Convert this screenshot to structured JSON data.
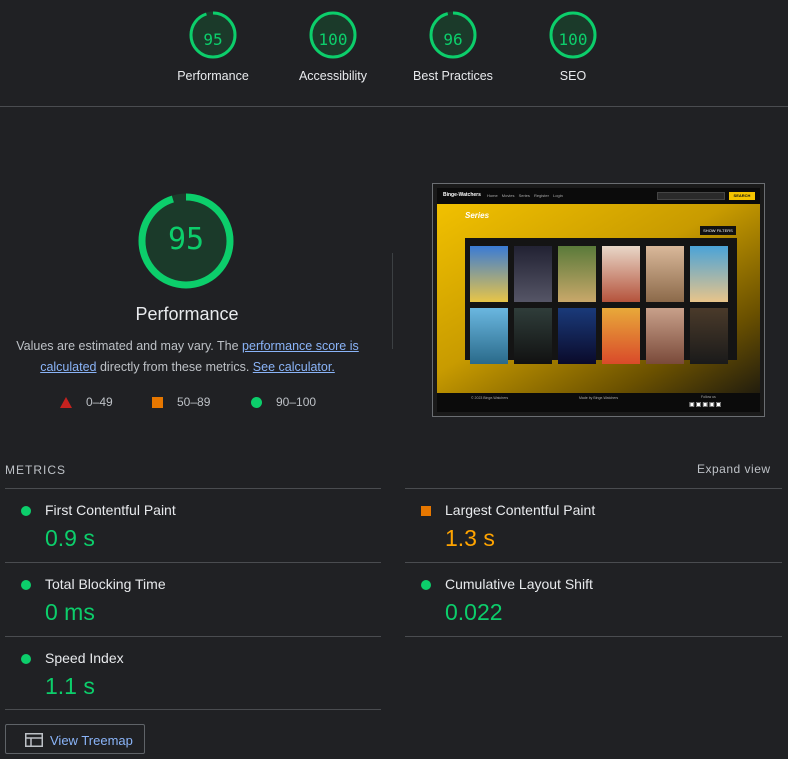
{
  "top_gauges": [
    {
      "score": "95",
      "label": "Performance",
      "fraction": 0.95
    },
    {
      "score": "100",
      "label": "Accessibility",
      "fraction": 1.0
    },
    {
      "score": "96",
      "label": "Best Practices",
      "fraction": 0.96
    },
    {
      "score": "100",
      "label": "SEO",
      "fraction": 1.0
    }
  ],
  "main_gauge": {
    "score": "95",
    "label": "Performance",
    "fraction": 0.95
  },
  "description": {
    "text1": "Values are estimated and may vary. The ",
    "link1": "performance score is calculated",
    "text2": " directly from these metrics. ",
    "link2": "See calculator."
  },
  "legend": [
    {
      "icon": "triangle-icon",
      "range": "0–49",
      "color": "#c5221f"
    },
    {
      "icon": "square-icon",
      "range": "50–89",
      "color": "#e67700"
    },
    {
      "icon": "circle-icon",
      "range": "90–100",
      "color": "#0cce6b"
    }
  ],
  "screenshot": {
    "brand": "Binge-Watchers",
    "nav_links": "Home Movies Series Register Login",
    "search_button": "SEARCH",
    "heading": "Series",
    "filter_button": "SHOW FILTERS",
    "footer_left": "© 2023 Binge-Watchers",
    "footer_center": "Made by Binge-Watchers",
    "footer_right": "Follow us"
  },
  "metrics_header": "METRICS",
  "expand_label": "Expand view",
  "metrics": [
    {
      "name": "First Contentful Paint",
      "value": "0.9 s",
      "status": "good"
    },
    {
      "name": "Largest Contentful Paint",
      "value": "1.3 s",
      "status": "average"
    },
    {
      "name": "Total Blocking Time",
      "value": "0 ms",
      "status": "good"
    },
    {
      "name": "Cumulative Layout Shift",
      "value": "0.022",
      "status": "good"
    },
    {
      "name": "Speed Index",
      "value": "1.1 s",
      "status": "good"
    }
  ],
  "treemap_button": "View Treemap",
  "colors": {
    "good": "#0cce6b",
    "average": "#ffa400",
    "fail": "#c5221f",
    "link": "#8ab4f8",
    "background": "#202124"
  }
}
